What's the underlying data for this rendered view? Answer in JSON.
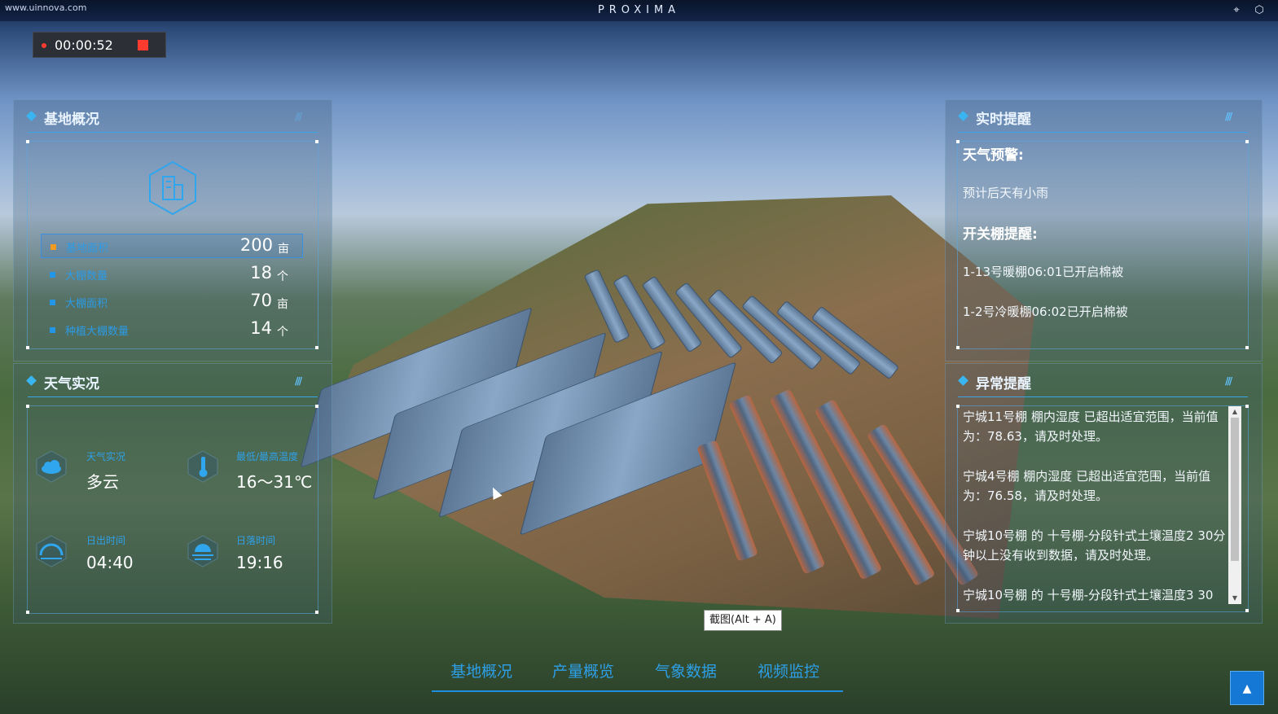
{
  "browser": {
    "url": "www.uinnova.com"
  },
  "header": {
    "brand": "PROXIMA",
    "icons": [
      "location-pin-icon",
      "cube-icon"
    ]
  },
  "recorder": {
    "time": "00:00:52"
  },
  "overview": {
    "title": "基地概况",
    "rows": [
      {
        "label": "基地面积",
        "value": "200",
        "unit": "亩"
      },
      {
        "label": "大棚数量",
        "value": "18",
        "unit": "个"
      },
      {
        "label": "大棚面积",
        "value": "70",
        "unit": "亩"
      },
      {
        "label": "种植大棚数量",
        "value": "14",
        "unit": "个"
      }
    ]
  },
  "weather": {
    "title": "天气实况",
    "items": [
      {
        "label": "天气实况",
        "value": "多云",
        "icon": "cloud-icon"
      },
      {
        "label": "最低/最高温度",
        "value": "16～31℃",
        "icon": "thermometer-icon"
      },
      {
        "label": "日出时间",
        "value": "04:40",
        "icon": "sunrise-icon"
      },
      {
        "label": "日落时间",
        "value": "19:16",
        "icon": "sunset-icon"
      }
    ]
  },
  "alerts": {
    "title": "实时提醒",
    "weather_heading": "天气预警:",
    "weather_text": "预计后天有小雨",
    "shed_heading": "开关棚提醒:",
    "shed_items": [
      "1-13号暖棚06:01已开启棉被",
      "1-2号冷暖棚06:02已开启棉被"
    ]
  },
  "abnormal": {
    "title": "异常提醒",
    "items": [
      "宁城11号棚 棚内湿度 已超出适宜范围，当前值为：78.63，请及时处理。",
      "宁城4号棚 棚内湿度 已超出适宜范围，当前值为：76.58，请及时处理。",
      "宁城10号棚 的 十号棚-分段针式土壤温度2 30分钟以上没有收到数据，请及时处理。",
      "宁城10号棚 的 十号棚-分段针式土壤温度3 30"
    ]
  },
  "tooltip": "截图(Alt + A)",
  "nav": [
    "基地概况",
    "产量概览",
    "气象数据",
    "视频监控"
  ],
  "colors": {
    "accent": "#2d9fe7",
    "selected": "#f39a21",
    "record": "#ff3b30"
  }
}
